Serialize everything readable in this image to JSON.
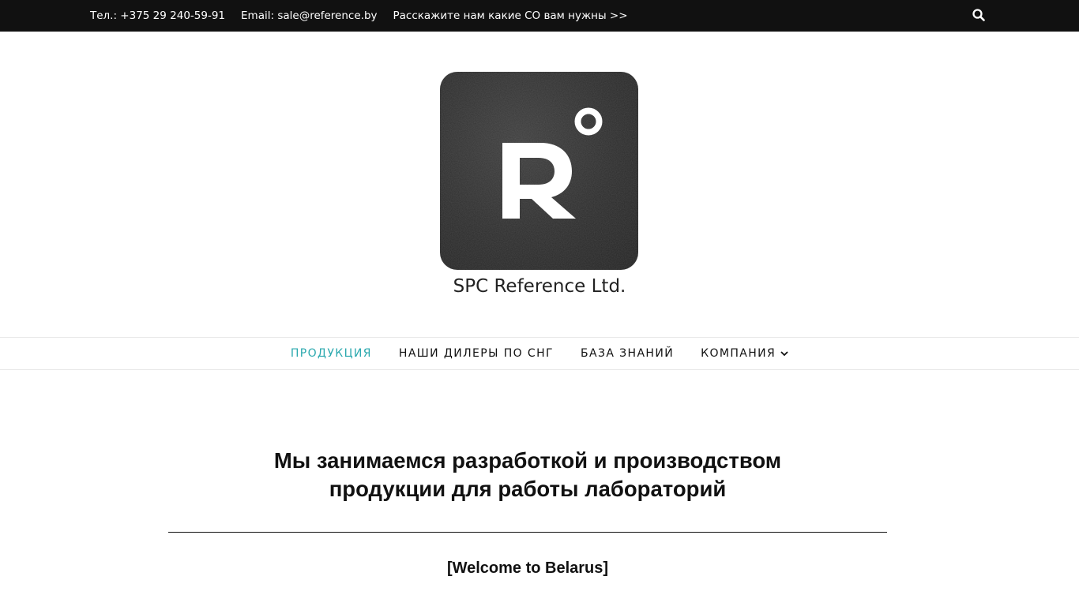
{
  "topbar": {
    "phone": "Тел.: +375 29 240-59-91",
    "email": "Email: sale@reference.by",
    "request_link": "Расскажите нам какие СО вам нужны >>",
    "search_icon": "search-icon"
  },
  "site": {
    "logo_icon": "logo-r-degree-icon",
    "title": "SPC Reference Ltd."
  },
  "nav": {
    "items": [
      {
        "label": "ПРОДУКЦИЯ",
        "active": true
      },
      {
        "label": "НАШИ ДИЛЕРЫ ПО СНГ",
        "active": false
      },
      {
        "label": "БАЗА ЗНАНИЙ",
        "active": false
      },
      {
        "label": "КОМПАНИЯ",
        "active": false,
        "dropdown": true
      }
    ]
  },
  "main": {
    "headline_line1": "Мы занимаемся разработкой и производством",
    "headline_line2": "продукции для работы лабораторий",
    "welcome": "[Welcome to Belarus]"
  },
  "colors": {
    "topbar_bg": "#111111",
    "accent": "#2aa8ae",
    "logo_bg": "#2c2c2c"
  }
}
